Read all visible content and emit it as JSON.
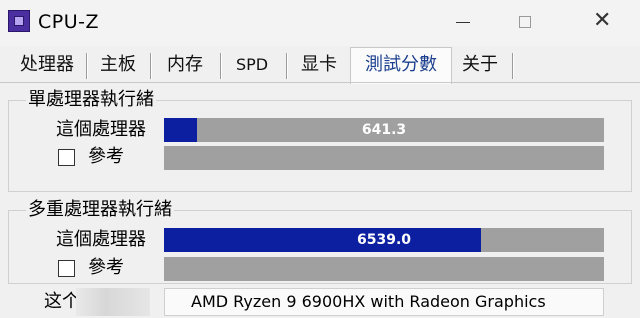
{
  "window": {
    "title": "CPU-Z",
    "icons": {
      "app": "cpu-z-app-icon",
      "minimize": "minimize-icon",
      "maximize": "maximize-icon",
      "close": "close-icon"
    },
    "close_glyph": "✕"
  },
  "tabs": [
    {
      "label": "处理器"
    },
    {
      "label": "主板"
    },
    {
      "label": "内存"
    },
    {
      "label": "SPD"
    },
    {
      "label": "显卡"
    },
    {
      "label": "測試分數",
      "active": true
    },
    {
      "label": "关于"
    }
  ],
  "single_thread": {
    "title": "單處理器執行緒",
    "this_cpu_label": "這個處理器",
    "this_cpu_score": "641.3",
    "this_cpu_fraction": 0.075,
    "reference_label": "參考",
    "reference_checked": false
  },
  "multi_thread": {
    "title": "多重處理器執行緒",
    "this_cpu_label": "這個處理器",
    "this_cpu_score": "6539.0",
    "this_cpu_fraction": 0.72,
    "reference_label": "參考",
    "reference_checked": false
  },
  "footer": {
    "label": "这个",
    "cpu_name": "AMD Ryzen 9 6900HX with Radeon Graphics"
  },
  "colors": {
    "bar_fill": "#0b1fa0",
    "bar_track": "#a0a0a0",
    "active_tab_text": "#1c3f8f"
  }
}
